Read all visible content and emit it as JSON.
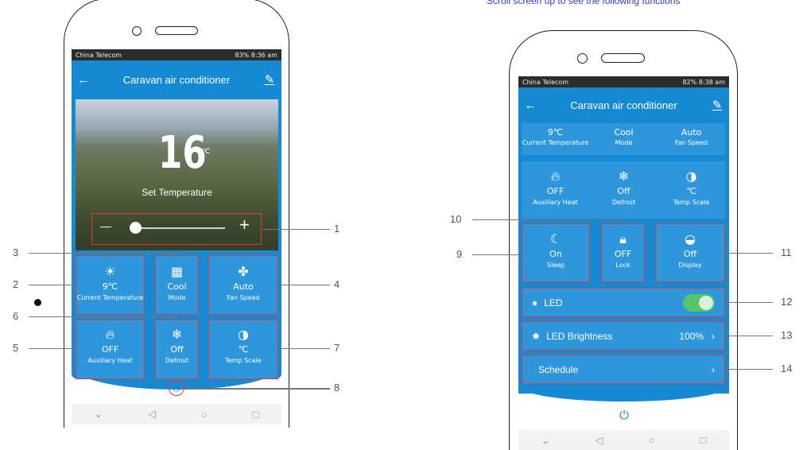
{
  "note": "Scroll screen up to see the following functions",
  "left": {
    "status_carrier": "China Telecom",
    "status_right": "83%  8:36 am",
    "title": "Caravan air conditioner",
    "temperature": "16",
    "temperature_unit": "℃",
    "set_label": "Set Temperature",
    "minus": "—",
    "plus": "+",
    "tiles": [
      {
        "value": "9℃",
        "label": "Current Temperature"
      },
      {
        "value": "Cool",
        "label": "Mode"
      },
      {
        "value": "Auto",
        "label": "Fan Speed"
      },
      {
        "value": "OFF",
        "label": "Auxiliary Heat"
      },
      {
        "value": "Off",
        "label": "Defrost"
      },
      {
        "value": "℃",
        "label": "Temp Scale"
      }
    ],
    "callouts": [
      "1",
      "2",
      "3",
      "4",
      "5",
      "6",
      "7",
      "8"
    ]
  },
  "right": {
    "status_carrier": "China Telecom",
    "status_right": "82%  8:38 am",
    "title": "Caravan air conditioner",
    "top_tiles": [
      {
        "value": "9℃",
        "label": "Current Temperature"
      },
      {
        "value": "Cool",
        "label": "Mode"
      },
      {
        "value": "Auto",
        "label": "Fan Speed"
      }
    ],
    "mid_tiles": [
      {
        "value": "OFF",
        "label": "Auxiliary Heat"
      },
      {
        "value": "Off",
        "label": "Defrost"
      },
      {
        "value": "℃",
        "label": "Temp Scale"
      }
    ],
    "bottom_tiles": [
      {
        "value": "On",
        "label": "Sleep"
      },
      {
        "value": "OFF",
        "label": "Lock"
      },
      {
        "value": "Off",
        "label": "Display"
      }
    ],
    "led_label": "LED",
    "brightness_label": "LED Brightness",
    "brightness_value": "100%",
    "schedule_label": "Schedule",
    "callouts": [
      "9",
      "10",
      "11",
      "12",
      "13",
      "14"
    ]
  },
  "accent": "#1589d4",
  "highlight": "#e53935"
}
